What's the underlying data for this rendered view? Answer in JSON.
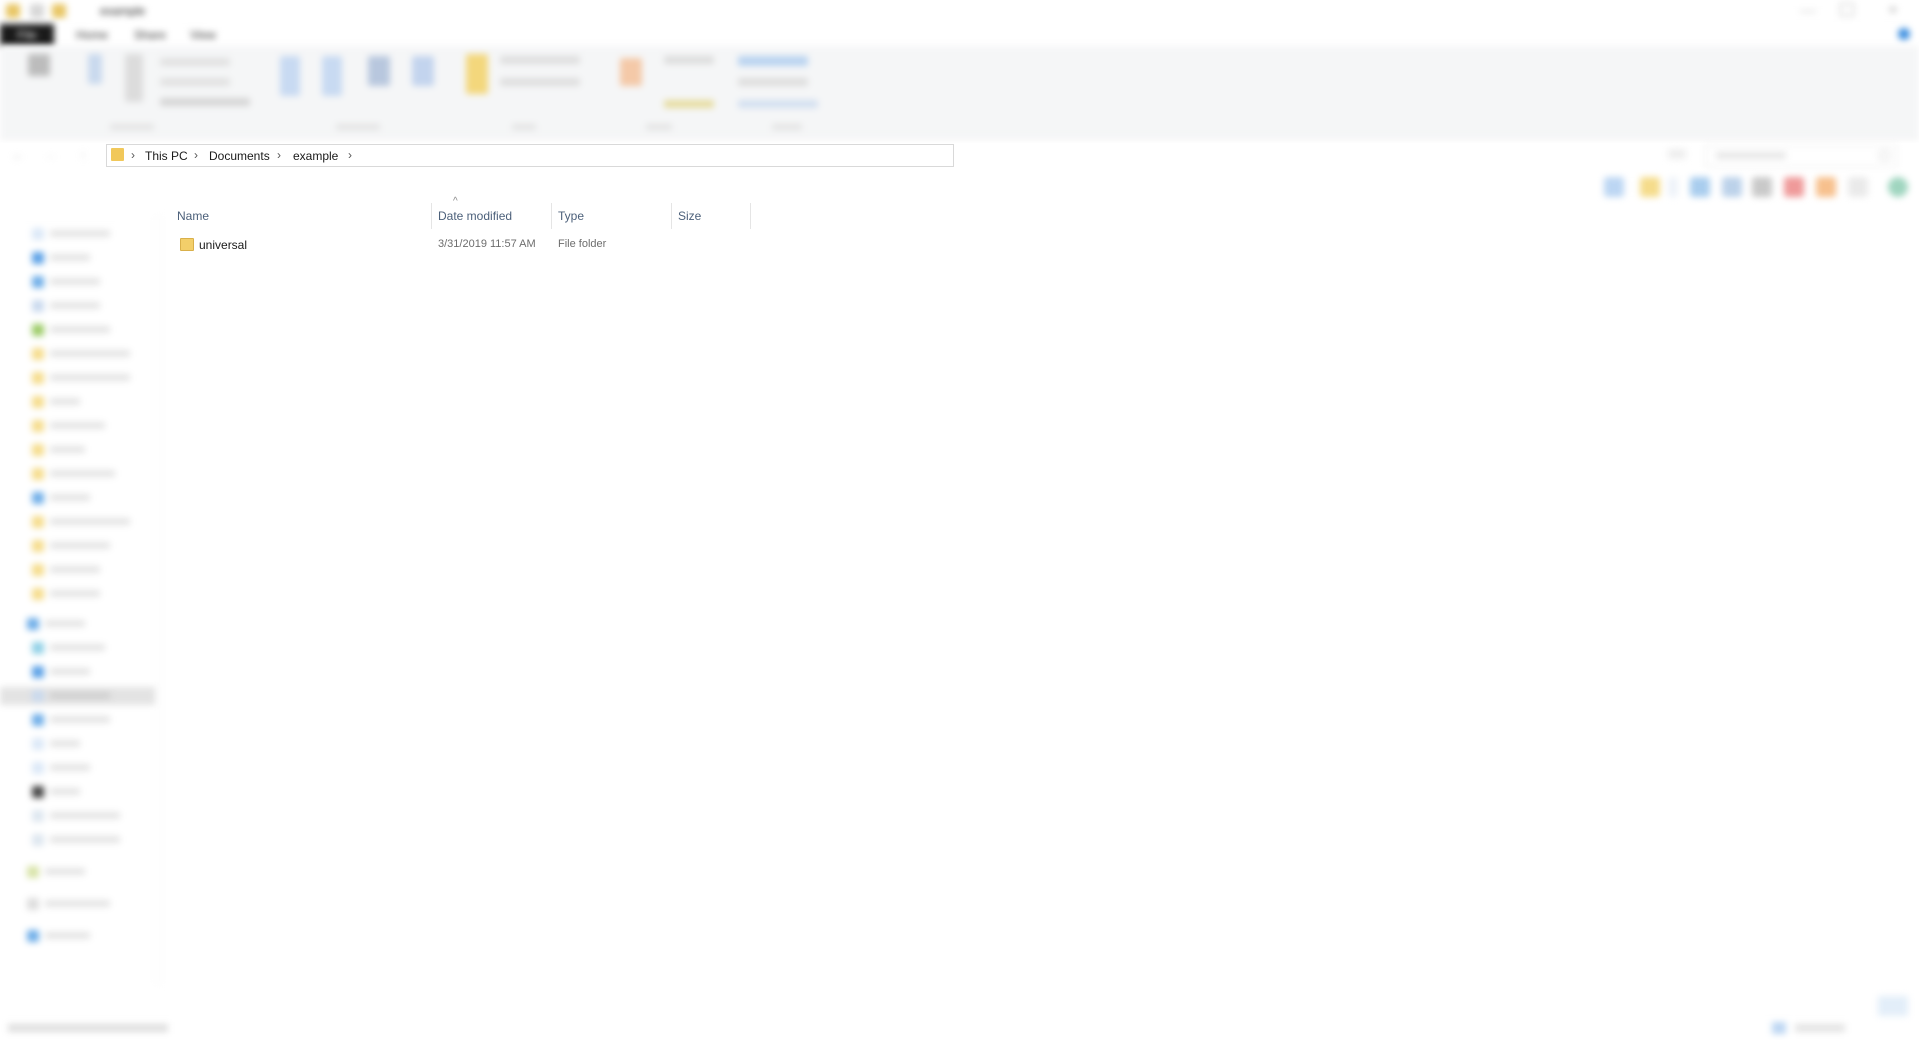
{
  "window": {
    "title": "example"
  },
  "ribbon_tabs": [
    "File",
    "Home",
    "Share",
    "View"
  ],
  "breadcrumb": [
    "This PC",
    "Documents",
    "example"
  ],
  "columns": [
    "Name",
    "Date modified",
    "Type",
    "Size"
  ],
  "files": [
    {
      "name": "universal",
      "date_modified": "3/31/2019 11:57 AM",
      "type": "File folder",
      "size": ""
    }
  ],
  "colors": {
    "folder": "#f3cf6a",
    "header_text": "#4c607a",
    "accent": "#2b7cd3"
  }
}
